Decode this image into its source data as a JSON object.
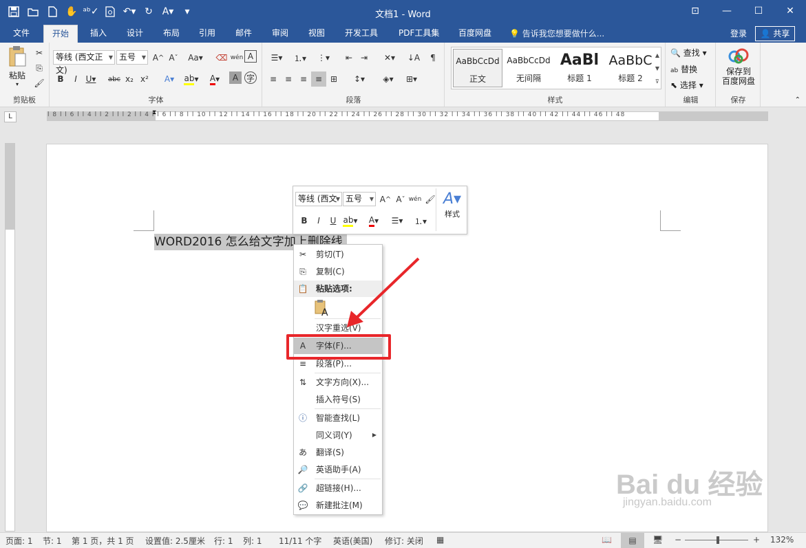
{
  "window": {
    "title": "文档1 - Word",
    "qat": [
      "save-icon",
      "open-icon",
      "new-icon",
      "touch-icon",
      "spelling-icon",
      "print-preview-icon",
      "undo-icon",
      "redo-icon",
      "format-icon",
      "customize-icon"
    ],
    "controls": {
      "ribbon_options": "⊡",
      "minimize": "—",
      "maximize": "☐",
      "close": "✕"
    }
  },
  "tabs": [
    {
      "label": "文件"
    },
    {
      "label": "开始"
    },
    {
      "label": "插入"
    },
    {
      "label": "设计"
    },
    {
      "label": "布局"
    },
    {
      "label": "引用"
    },
    {
      "label": "邮件"
    },
    {
      "label": "审阅"
    },
    {
      "label": "视图"
    },
    {
      "label": "开发工具"
    },
    {
      "label": "PDF工具集"
    },
    {
      "label": "百度网盘"
    }
  ],
  "tellme": "告诉我您想要做什么...",
  "login": "登录",
  "share": "共享",
  "ribbon": {
    "clipboard": {
      "paste": "粘贴",
      "label": "剪贴板"
    },
    "font": {
      "name": "等线 (西文正文)",
      "size": "五号",
      "label": "字体"
    },
    "paragraph": {
      "label": "段落"
    },
    "styles": {
      "label": "样式",
      "items": [
        {
          "preview": "AaBbCcDd",
          "name": "正文"
        },
        {
          "preview": "AaBbCcDd",
          "name": "无间隔"
        },
        {
          "preview": "AaBl",
          "name": "标题 1"
        },
        {
          "preview": "AaBbC",
          "name": "标题 2"
        }
      ]
    },
    "editing": {
      "find": "查找",
      "replace": "替换",
      "select": "选择",
      "label": "编辑"
    },
    "save": {
      "button": "保存到\n百度网盘",
      "label": "保存"
    }
  },
  "ruler": {
    "numbers": "l 8 l  l 6 l  l 4 l  l 2 l  l    l 2 l  l 4 l  l 6 l  l 8 l  l 10 l  l 12 l  l 14 l  l 16 l  l 18 l  l 20 l  l 22 l  l 24 l  l 26 l  l 28 l  l 30 l  l 32 l  l 34 l  l 36 l  l 38 l  l 40 l  l 42 l  l 44 l  l 46 l  l 48"
  },
  "document": {
    "text": "WORD2016 怎么给文字加上删除线"
  },
  "mini_toolbar": {
    "font": "等线 (西文",
    "size": "五号",
    "styles": "样式"
  },
  "context_menu": {
    "items": [
      {
        "label": "剪切(T)",
        "icon": "cut-icon"
      },
      {
        "label": "复制(C)",
        "icon": "copy-icon"
      },
      {
        "label": "粘贴选项:",
        "icon": "paste-icon"
      },
      {
        "label": "汉字重选(V)",
        "icon": ""
      },
      {
        "label": "字体(F)...",
        "icon": "font-icon"
      },
      {
        "label": "段落(P)...",
        "icon": "paragraph-icon"
      },
      {
        "label": "文字方向(X)...",
        "icon": "text-direction-icon"
      },
      {
        "label": "插入符号(S)",
        "icon": ""
      },
      {
        "label": "智能查找(L)",
        "icon": "smart-lookup-icon"
      },
      {
        "label": "同义词(Y)",
        "icon": ""
      },
      {
        "label": "翻译(S)",
        "icon": "translate-icon"
      },
      {
        "label": "英语助手(A)",
        "icon": "english-assistant-icon"
      },
      {
        "label": "超链接(H)...",
        "icon": "hyperlink-icon"
      },
      {
        "label": "新建批注(M)",
        "icon": "comment-icon"
      }
    ]
  },
  "status": {
    "page": "页面: 1",
    "section": "节: 1",
    "pages": "第 1 页，共 1 页",
    "position": "设置值: 2.5厘米",
    "line": "行: 1",
    "column": "列: 1",
    "words": "11/11 个字",
    "language": "英语(美国)",
    "track": "修订: 关闭",
    "zoom_minus": "−",
    "zoom_plus": "+",
    "zoom": "132%"
  },
  "watermark": {
    "brand": "Bai du 经验",
    "url": "jingyan.baidu.com"
  },
  "colors": {
    "accent": "#2b579a",
    "highlight_box": "#e8262a"
  }
}
